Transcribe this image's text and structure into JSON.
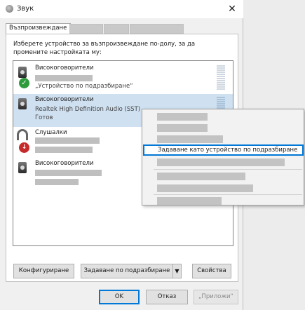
{
  "window": {
    "title": "Звук",
    "close_glyph": "✕"
  },
  "tabs": [
    {
      "label": "Възпроизвеждане"
    }
  ],
  "instructions": "Изберете устройство за възпроизвеждане по-долу, за да промените настройката му:",
  "devices": [
    {
      "name": "Високоговорители",
      "line3": "„Устройство по подразбиране“",
      "icon": "speaker-icon",
      "badge": "checkmark-icon"
    },
    {
      "name": "Високоговорители",
      "line2": "Realtek High Definition Audio (SST)",
      "line3": "Готов",
      "icon": "speaker-icon"
    },
    {
      "name": "Слушалки",
      "icon": "headphones-icon",
      "badge": "down-arrow-icon"
    },
    {
      "name": "Високоговорители",
      "icon": "speaker-icon"
    }
  ],
  "context_menu": {
    "highlighted_item": "Задаване като устройство по подразбиране"
  },
  "buttons": {
    "configure": "Конфигуриране",
    "set_default": "Задаване по подразбиране",
    "dropdown_arrow": "▼",
    "properties": "Свойства",
    "ok": "OK",
    "cancel": "Отказ",
    "apply": "„Приложи“"
  },
  "colors": {
    "selection": "#cfe0f0",
    "accent": "#0078d7",
    "ok_badge": "#2e9b3c",
    "down_badge": "#c62b2b"
  }
}
